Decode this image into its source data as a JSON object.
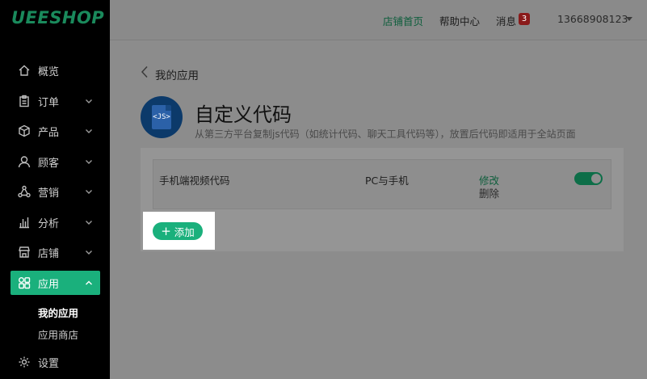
{
  "brand": {
    "logo_text": "UEESHOP"
  },
  "sidebar": {
    "items": [
      {
        "label": "概览",
        "icon": "home-icon"
      },
      {
        "label": "订单",
        "icon": "clipboard-icon"
      },
      {
        "label": "产品",
        "icon": "box-icon"
      },
      {
        "label": "顾客",
        "icon": "user-icon"
      },
      {
        "label": "营销",
        "icon": "share-icon"
      },
      {
        "label": "分析",
        "icon": "bar-chart-icon"
      },
      {
        "label": "店铺",
        "icon": "store-icon"
      },
      {
        "label": "应用",
        "icon": "apps-icon"
      },
      {
        "label": "设置",
        "icon": "gear-icon"
      }
    ],
    "sub_items": [
      {
        "label": "我的应用"
      },
      {
        "label": "应用商店"
      }
    ],
    "active_color": "#1ab07c"
  },
  "topbar": {
    "store_home": "店铺首页",
    "help_center": "帮助中心",
    "messages": "消息",
    "message_count": "3",
    "account": "13668908123"
  },
  "main": {
    "breadcrumb": "我的应用",
    "icon_text": "<JS>",
    "title": "自定义代码",
    "subtitle": "从第三方平台复制js代码（如统计代码、聊天工具代码等），放置后代码即适用于全站页面",
    "rows": [
      {
        "name": "手机端视频代码",
        "platform": "PC与手机",
        "edit": "修改",
        "delete": "删除",
        "enabled": true
      }
    ],
    "add_button": "添加"
  }
}
